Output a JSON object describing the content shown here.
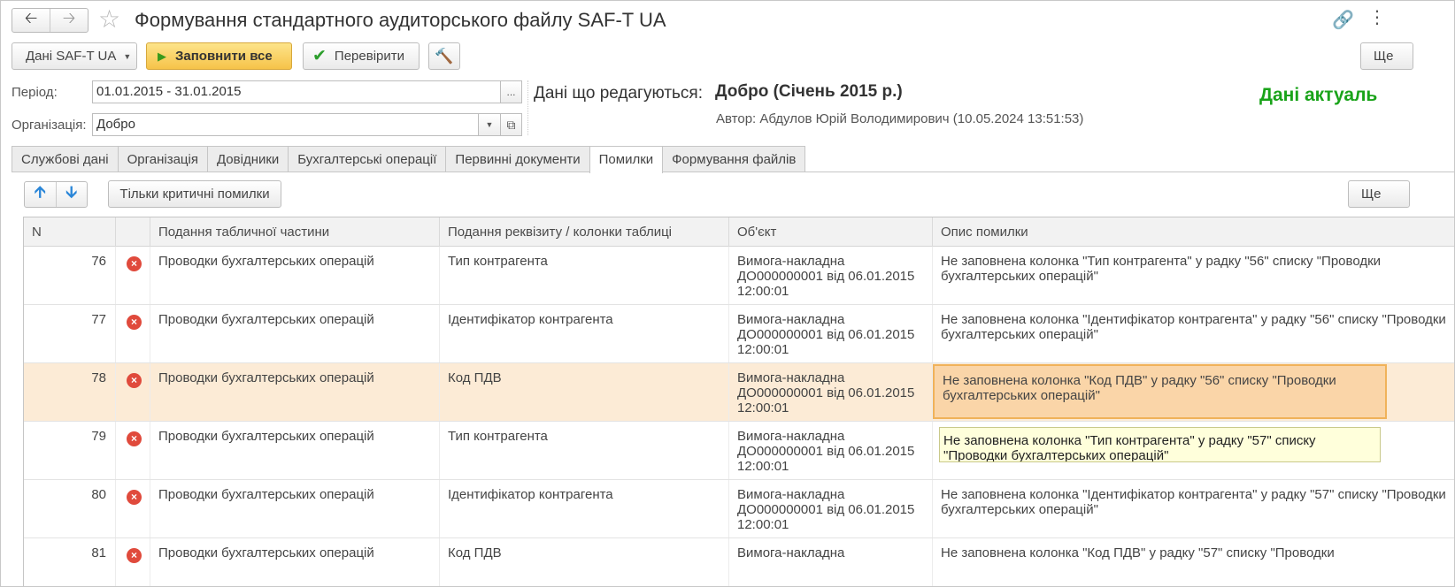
{
  "header": {
    "title": "Формування стандартного аудиторського файлу SAF-T UA"
  },
  "toolbar": {
    "data_label": "Дані SAF-T UA",
    "fill_label": "Заповнити все",
    "check_label": "Перевірити",
    "more_label": "Ще"
  },
  "form": {
    "period_label": "Період:",
    "period_value": "01.01.2015 - 31.01.2015",
    "period_button": "...",
    "org_label": "Організація:",
    "org_value": "Добро",
    "editing_label": "Дані що редагуються:",
    "editing_value": "Добро (Січень 2015 р.)",
    "author": "Автор: Абдулов Юрій Володимирович (10.05.2024 13:51:53)",
    "status": "Дані актуаль"
  },
  "tabs": [
    "Службові дані",
    "Організація",
    "Довідники",
    "Бухгалтерські операції",
    "Первинні документи",
    "Помилки",
    "Формування файлів"
  ],
  "active_tab": "Помилки",
  "subtoolbar": {
    "critical_label": "Тільки критичні помилки",
    "more_label": "Ще"
  },
  "table": {
    "columns": [
      "N",
      "",
      "Подання табличної частини",
      "Подання реквізиту / колонки таблиці",
      "Об'єкт",
      "Опис помилки"
    ],
    "rows": [
      {
        "n": "76",
        "part": "Проводки бухгалтерських операцій",
        "attr": "Тип контрагента",
        "object": "Вимога-накладна ДО000000001 від 06.01.2015 12:00:01",
        "desc": "Не заповнена колонка \"Тип контрагента\" у радку \"56\" списку \"Проводки бухгалтерських операцій\""
      },
      {
        "n": "77",
        "part": "Проводки бухгалтерських операцій",
        "attr": "Ідентифікатор контрагента",
        "object": "Вимога-накладна ДО000000001 від 06.01.2015 12:00:01",
        "desc": "Не заповнена колонка \"Ідентифікатор контрагента\" у радку \"56\" списку \"Проводки бухгалтерських операцій\""
      },
      {
        "n": "78",
        "part": "Проводки бухгалтерських операцій",
        "attr": "Код ПДВ",
        "object": "Вимога-накладна ДО000000001 від 06.01.2015 12:00:01",
        "desc": "Не заповнена колонка \"Код ПДВ\" у радку \"56\" списку \"Проводки бухгалтерських операцій\""
      },
      {
        "n": "79",
        "part": "Проводки бухгалтерських операцій",
        "attr": "Тип контрагента",
        "object": "Вимога-накладна ДО000000001 від 06.01.2015 12:00:01",
        "desc": "Не заповнена колонка \"Тип контрагента\" у радку \"57\" списку \"Проводки бухгалтерських операцій\""
      },
      {
        "n": "80",
        "part": "Проводки бухгалтерських операцій",
        "attr": "Ідентифікатор контрагента",
        "object": "Вимога-накладна ДО000000001 від 06.01.2015 12:00:01",
        "desc": "Не заповнена колонка \"Ідентифікатор контрагента\" у радку \"57\" списку \"Проводки бухгалтерських операцій\""
      },
      {
        "n": "81",
        "part": "Проводки бухгалтерських операцій",
        "attr": "Код ПДВ",
        "object": "Вимога-накладна",
        "desc": "Не заповнена колонка \"Код ПДВ\" у радку \"57\" списку \"Проводки"
      }
    ],
    "selected_row": 2,
    "tooltip_row": 3
  },
  "colors": {
    "fill_button": "#f6c349",
    "status_green": "#19a319",
    "selected_row": "#fcebd6",
    "error_icon": "#e04a3c"
  },
  "icons": [
    "back-arrow-icon",
    "forward-arrow-icon",
    "favorite-star-icon",
    "link-icon",
    "more-vertical-icon",
    "play-icon",
    "checkmark-icon",
    "tools-icon",
    "arrow-up-icon",
    "arrow-down-icon",
    "error-icon"
  ]
}
